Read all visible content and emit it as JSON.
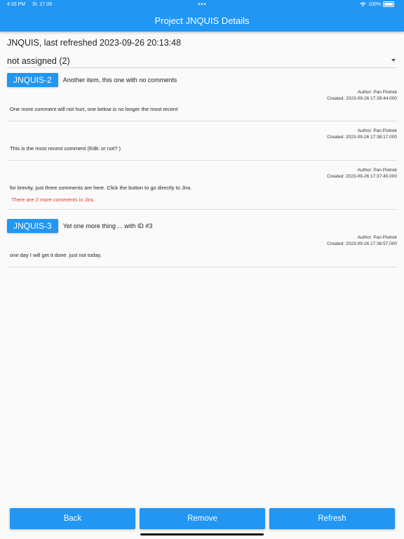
{
  "status_bar": {
    "time": "4:33 PM",
    "date": "Śr. 27.09",
    "dots": "•••",
    "battery": "100%"
  },
  "app_bar": {
    "title": "Project JNQUIS Details"
  },
  "header": {
    "refresh_line": "JNQUIS, last refreshed 2023-09-26 20:13:48"
  },
  "filter": {
    "selected": "not assigned (2)"
  },
  "issues": [
    {
      "key": "JNQUIS-2",
      "summary": "Another item, this one with no comments",
      "comments": [
        {
          "author": "Author: Pan Piotrek",
          "created": "Created: 2023-09-26 17:39:44.000",
          "body": "One more comment will not hurt, one below is no longer the most recent"
        },
        {
          "author": "Author: Pan Piotrek",
          "created": "Created: 2023-09-26 17:38:17.000",
          "body": "This is the most recent comment (Edit: or not? )"
        },
        {
          "author": "Author: Pan Piotrek",
          "created": "Created: 2023-09-26 17:37:45.000",
          "body": "for brevity, just three comments are here. Click the button to go directly to Jira."
        }
      ],
      "more_comments": "There are 2 more comments in Jira."
    },
    {
      "key": "JNQUIS-3",
      "summary": "Yet one more thing ... with ID #3",
      "comments": [
        {
          "author": "Author: Pan Piotrek",
          "created": "Created: 2023-09-26 17:36:57.000",
          "body": "one day I will get it done. just not today."
        }
      ]
    }
  ],
  "buttons": {
    "back": "Back",
    "remove": "Remove",
    "refresh": "Refresh"
  },
  "colors": {
    "accent": "#2196f3",
    "warning_text": "#e53935",
    "background": "#fafafa"
  }
}
